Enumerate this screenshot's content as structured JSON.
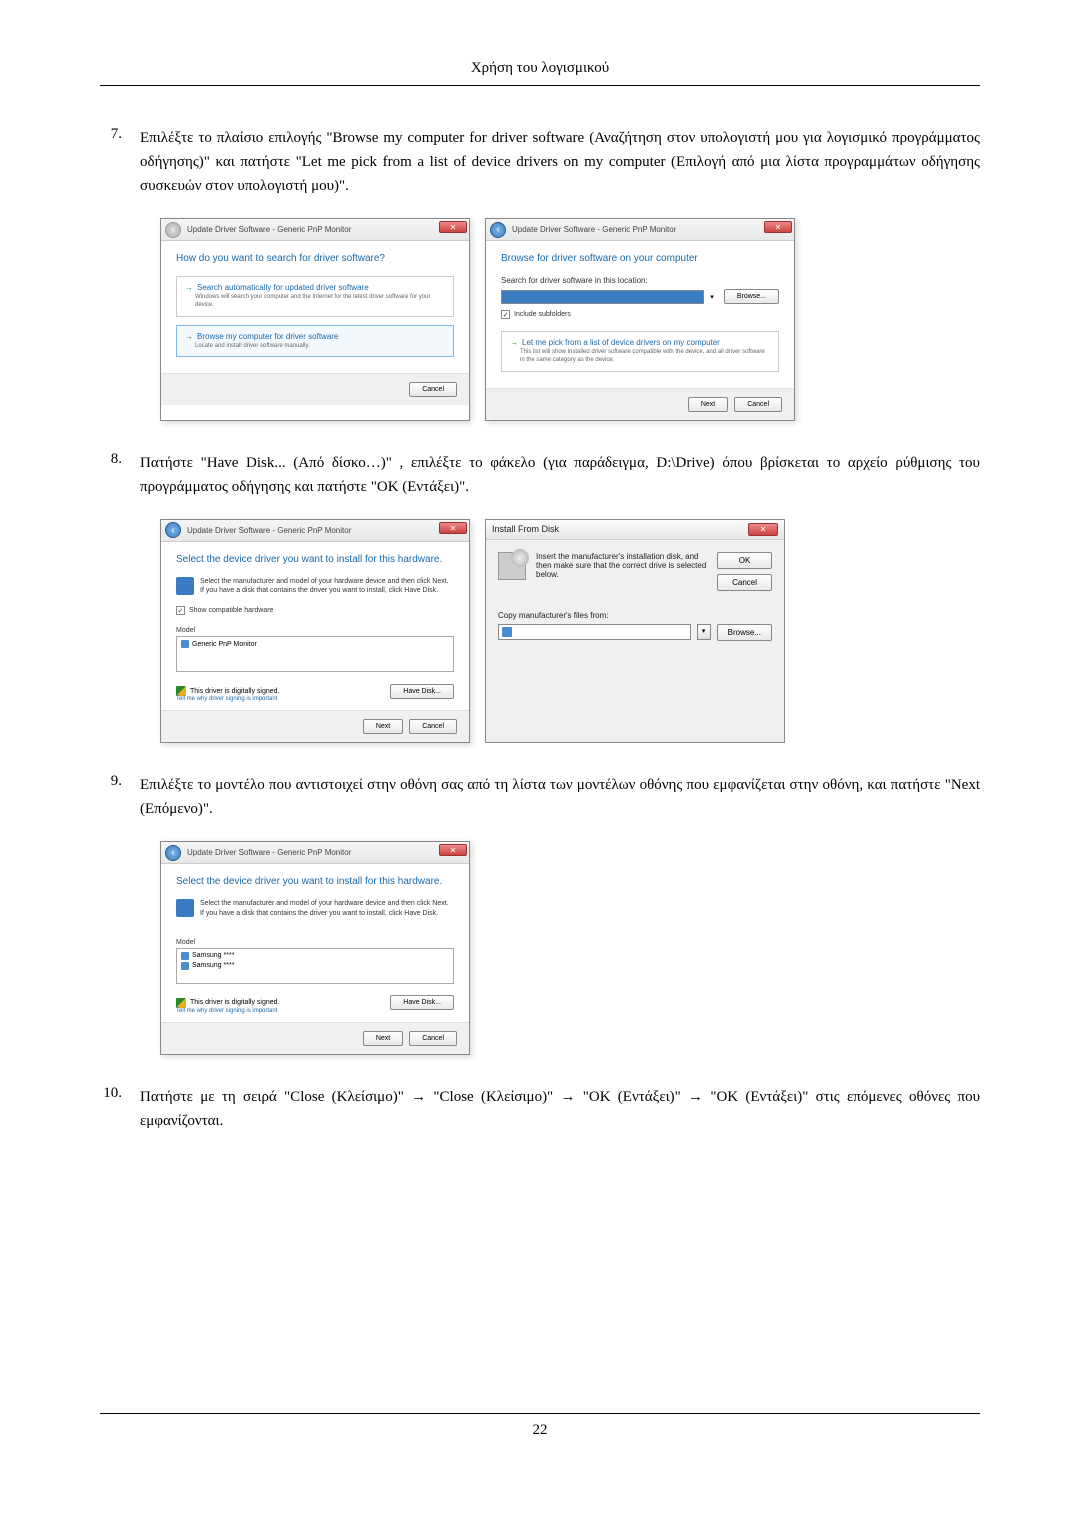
{
  "header_title": "Χρήση του λογισμικού",
  "page_number": "22",
  "steps": {
    "s7": {
      "num": "7.",
      "text": "Επιλέξτε το πλαίσιο επιλογής \"Browse my computer for driver software (Αναζήτηση στον υπολογιστή μου για λογισμικό προγράμματος οδήγησης)\" και πατήστε \"Let me pick from a list of device drivers on my computer (Επιλογή από μια λίστα προγραμμάτων οδήγησης συσκευών στον υπολογιστή μου)\"."
    },
    "s8": {
      "num": "8.",
      "text": "Πατήστε \"Have Disk... (Από δίσκο…)\" , επιλέξτε το φάκελο (για παράδειγμα, D:\\Drive) όπου βρίσκεται το αρχείο ρύθμισης του προγράμματος οδήγησης και πατήστε \"OK (Εντάξει)\"."
    },
    "s9": {
      "num": "9.",
      "text": "Επιλέξτε το μοντέλο που αντιστοιχεί στην οθόνη σας από τη λίστα των μοντέλων οθόνης που εμφανίζεται στην οθόνη, και πατήστε \"Next (Επόμενο)\"."
    },
    "s10": {
      "num": "10.",
      "text": "Πατήστε με τη σειρά \"Close (Κλείσιμο)\" → \"Close (Κλείσιμο)\" → \"OK (Εντάξει)\" → \"OK (Εντάξει)\" στις επόμενες οθόνες που εμφανίζονται."
    }
  },
  "dlg7a": {
    "title": "Update Driver Software - Generic PnP Monitor",
    "heading": "How do you want to search for driver software?",
    "opt1_title": "Search automatically for updated driver software",
    "opt1_desc": "Windows will search your computer and the Internet for the latest driver software for your device.",
    "opt2_title": "Browse my computer for driver software",
    "opt2_desc": "Locate and install driver software manually.",
    "cancel": "Cancel"
  },
  "dlg7b": {
    "title": "Update Driver Software - Generic PnP Monitor",
    "heading": "Browse for driver software on your computer",
    "search_label": "Search for driver software in this location:",
    "browse": "Browse...",
    "include": "Include subfolders",
    "opt_title": "Let me pick from a list of device drivers on my computer",
    "opt_desc": "This list will show installed driver software compatible with the device, and all driver software in the same category as the device.",
    "next": "Next",
    "cancel": "Cancel"
  },
  "dlg8a": {
    "title": "Update Driver Software - Generic PnP Monitor",
    "heading": "Select the device driver you want to install for this hardware.",
    "sub": "Select the manufacturer and model of your hardware device and then click Next. If you have a disk that contains the driver you want to install, click Have Disk.",
    "compat": "Show compatible hardware",
    "model_label": "Model",
    "model_item": "Generic PnP Monitor",
    "signed": "This driver is digitally signed.",
    "tell": "Tell me why driver signing is important",
    "have_disk": "Have Disk...",
    "next": "Next",
    "cancel": "Cancel"
  },
  "dlg8b": {
    "title": "Install From Disk",
    "msg1": "Insert the manufacturer's installation disk, and then make sure that the correct drive is selected below.",
    "ok": "OK",
    "cancel": "Cancel",
    "copy_label": "Copy manufacturer's files from:",
    "browse": "Browse..."
  },
  "dlg9": {
    "title": "Update Driver Software - Generic PnP Monitor",
    "heading": "Select the device driver you want to install for this hardware.",
    "sub": "Select the manufacturer and model of your hardware device and then click Next. If you have a disk that contains the driver you want to install, click Have Disk.",
    "model_label": "Model",
    "model_item1": "Samsung ****",
    "model_item2": "Samsung ****",
    "signed": "This driver is digitally signed.",
    "tell": "Tell me why driver signing is important",
    "have_disk": "Have Disk...",
    "next": "Next",
    "cancel": "Cancel"
  }
}
